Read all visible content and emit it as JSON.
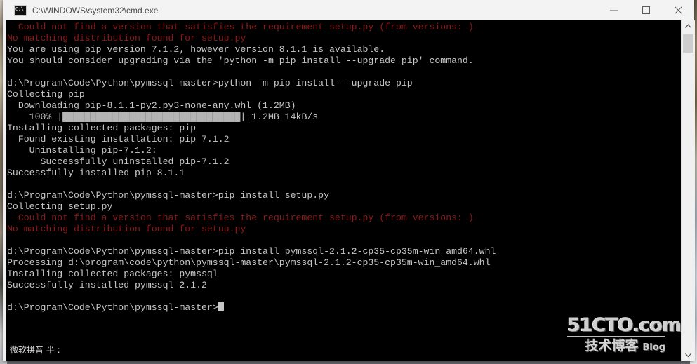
{
  "window": {
    "title": "C:\\WINDOWS\\system32\\cmd.exe",
    "icon": "cmd-icon",
    "controls": {
      "minimize_label": "Minimize",
      "maximize_label": "Maximize",
      "close_label": "Close"
    }
  },
  "console": {
    "prompt": "d:\\Program\\Code\\Python\\pymssql-master>",
    "colors": {
      "background": "#000000",
      "foreground": "#c6c6c6",
      "error": "#8b1a1a"
    },
    "lines": [
      {
        "text": "  Could not find a version that satisfies the requirement setup.py (from versions: )",
        "color": "error"
      },
      {
        "text": "No matching distribution found for setup.py",
        "color": "error"
      },
      {
        "text": "You are using pip version 7.1.2, however version 8.1.1 is available.",
        "color": "normal"
      },
      {
        "text": "You should consider upgrading via the 'python -m pip install --upgrade pip' command.",
        "color": "normal"
      },
      {
        "text": "",
        "color": "normal"
      },
      {
        "text": "d:\\Program\\Code\\Python\\pymssql-master>python -m pip install --upgrade pip",
        "color": "normal"
      },
      {
        "text": "Collecting pip",
        "color": "normal"
      },
      {
        "text": "  Downloading pip-8.1.1-py2.py3-none-any.whl (1.2MB)",
        "color": "normal"
      },
      {
        "text": "    100% |████████████████████████████████| 1.2MB 14kB/s",
        "color": "normal"
      },
      {
        "text": "Installing collected packages: pip",
        "color": "normal"
      },
      {
        "text": "  Found existing installation: pip 7.1.2",
        "color": "normal"
      },
      {
        "text": "    Uninstalling pip-7.1.2:",
        "color": "normal"
      },
      {
        "text": "      Successfully uninstalled pip-7.1.2",
        "color": "normal"
      },
      {
        "text": "Successfully installed pip-8.1.1",
        "color": "normal"
      },
      {
        "text": "",
        "color": "normal"
      },
      {
        "text": "d:\\Program\\Code\\Python\\pymssql-master>pip install setup.py",
        "color": "normal"
      },
      {
        "text": "Collecting setup.py",
        "color": "normal"
      },
      {
        "text": "  Could not find a version that satisfies the requirement setup.py (from versions: )",
        "color": "error"
      },
      {
        "text": "No matching distribution found for setup.py",
        "color": "error"
      },
      {
        "text": "",
        "color": "normal"
      },
      {
        "text": "d:\\Program\\Code\\Python\\pymssql-master>pip install pymssql-2.1.2-cp35-cp35m-win_amd64.whl",
        "color": "normal"
      },
      {
        "text": "Processing d:\\program\\code\\python\\pymssql-master\\pymssql-2.1.2-cp35-cp35m-win_amd64.whl",
        "color": "normal"
      },
      {
        "text": "Installing collected packages: pymssql",
        "color": "normal"
      },
      {
        "text": "Successfully installed pymssql-2.1.2",
        "color": "normal"
      },
      {
        "text": "",
        "color": "normal"
      }
    ],
    "download_progress": {
      "percent": "100%",
      "size": "1.2MB",
      "speed": "14kB/s"
    }
  },
  "ime": {
    "text": "微软拼音 半 :"
  },
  "watermark": {
    "top": "51CTO.com",
    "bottom_cn": "技术博客",
    "bottom_en": "Blog"
  },
  "scrollbar": {
    "up_label": "Scroll up",
    "down_label": "Scroll down",
    "thumb_label": "Scroll thumb"
  }
}
